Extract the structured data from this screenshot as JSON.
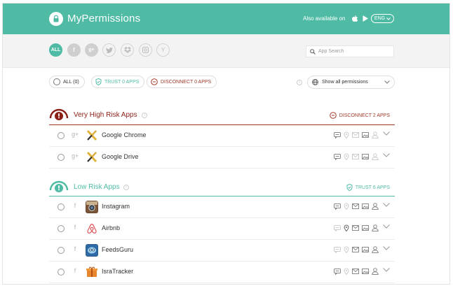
{
  "header": {
    "brand": "MyPermissions",
    "also_available": "Also available on",
    "language": "ENG",
    "accent": "#4fbba5"
  },
  "filters": {
    "all_label": "ALL",
    "sources": [
      "facebook",
      "google-plus",
      "twitter",
      "dropbox",
      "instagram",
      "yahoo"
    ],
    "search_placeholder": "App Search"
  },
  "actions": {
    "all_label": "ALL (0)",
    "trust_label": "TRUST 0 APPS",
    "disconnect_label": "DISCONNECT 0 APPS",
    "show_select": "Show all permissions"
  },
  "sections": {
    "high": {
      "title": "Very High Risk Apps",
      "action": "DISCONNECT 2 APPS",
      "color": "#8b1f16",
      "apps": [
        {
          "name": "Google Chrome",
          "source": "google-plus"
        },
        {
          "name": "Google Drive",
          "source": "google-plus"
        }
      ]
    },
    "low": {
      "title": "Low Risk Apps",
      "action": "TRUST 6 APPS",
      "color": "#4fbba5",
      "apps": [
        {
          "name": "Instagram",
          "source": "facebook"
        },
        {
          "name": "Airbnb",
          "source": "facebook"
        },
        {
          "name": "FeedsGuru",
          "source": "facebook"
        },
        {
          "name": "IsraTracker",
          "source": "facebook"
        }
      ]
    }
  },
  "icons": {
    "src_google": "g+",
    "src_facebook": "f",
    "y_label": "Y"
  }
}
